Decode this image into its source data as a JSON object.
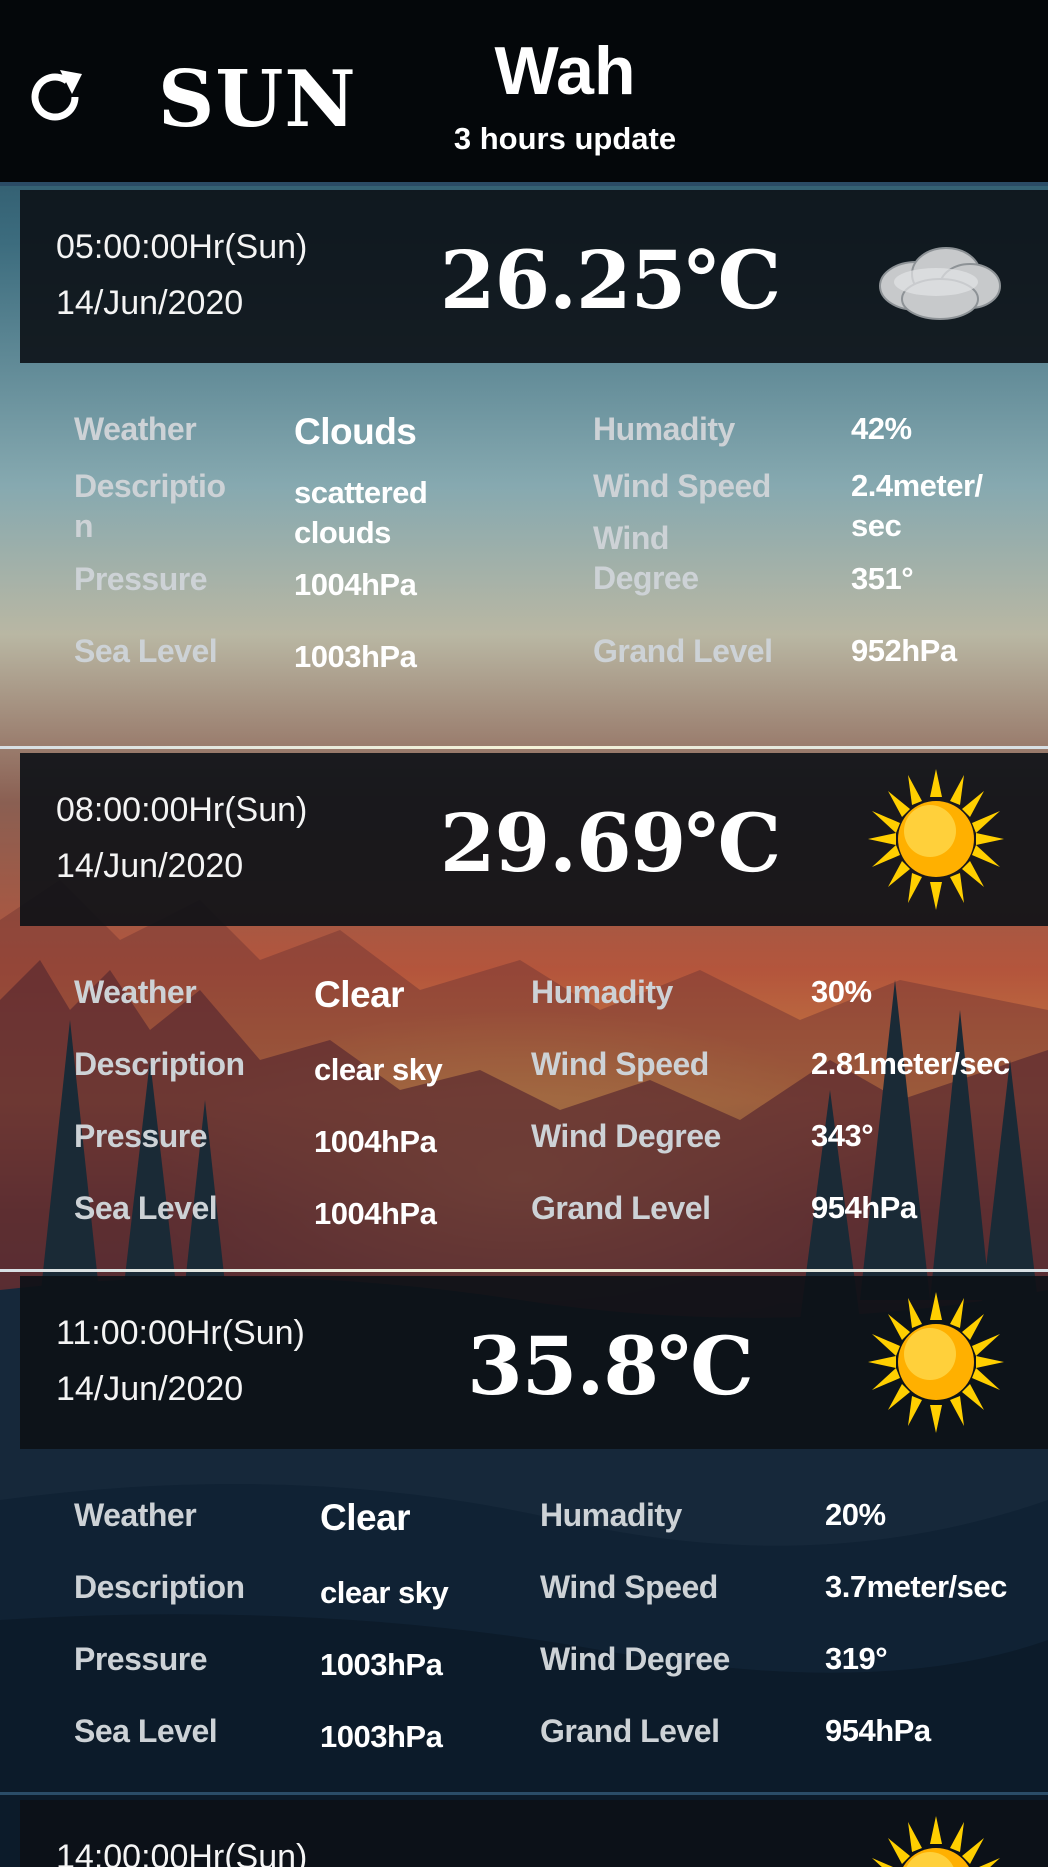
{
  "header": {
    "day": "SUN",
    "city": "Wah",
    "update_note": "3 hours update"
  },
  "forecasts": [
    {
      "time": "05:00:00Hr(Sun)",
      "date": "14/Jun/2020",
      "temperature": "26.25℃",
      "icon": "cloud-icon",
      "weather_label": "Weather",
      "weather": "Clouds",
      "description_label": "Descriptio\nn",
      "description": "scattered\nclouds",
      "pressure_label": "Pressure",
      "pressure": "1004hPa",
      "sea_level_label": "Sea Level",
      "sea_level": "1003hPa",
      "humidity_label": "Humadity",
      "humidity": "42%",
      "wind_speed_label": "Wind Speed",
      "wind_speed": "2.4meter/\nsec",
      "wind_degree_label": "Wind\nDegree",
      "wind_degree": "351°",
      "grand_level_label": "Grand Level",
      "grand_level": "952hPa"
    },
    {
      "time": "08:00:00Hr(Sun)",
      "date": "14/Jun/2020",
      "temperature": "29.69℃",
      "icon": "sun-icon",
      "weather_label": "Weather",
      "weather": "Clear",
      "description_label": "Description",
      "description": "clear sky",
      "pressure_label": "Pressure",
      "pressure": "1004hPa",
      "sea_level_label": "Sea Level",
      "sea_level": "1004hPa",
      "humidity_label": "Humadity",
      "humidity": "30%",
      "wind_speed_label": "Wind Speed",
      "wind_speed": "2.81meter/sec",
      "wind_degree_label": "Wind Degree",
      "wind_degree": "343°",
      "grand_level_label": "Grand Level",
      "grand_level": "954hPa"
    },
    {
      "time": "11:00:00Hr(Sun)",
      "date": "14/Jun/2020",
      "temperature": "35.8℃",
      "icon": "sun-icon",
      "weather_label": "Weather",
      "weather": "Clear",
      "description_label": "Description",
      "description": "clear sky",
      "pressure_label": "Pressure",
      "pressure": "1003hPa",
      "sea_level_label": "Sea Level",
      "sea_level": "1003hPa",
      "humidity_label": "Humadity",
      "humidity": "20%",
      "wind_speed_label": "Wind Speed",
      "wind_speed": "3.7meter/sec",
      "wind_degree_label": "Wind Degree",
      "wind_degree": "319°",
      "grand_level_label": "Grand Level",
      "grand_level": "954hPa"
    },
    {
      "time": "14:00:00Hr(Sun)",
      "icon": "sun-icon"
    }
  ],
  "icons": {
    "refresh": "refresh-icon",
    "cloud": "cloud-icon",
    "sun": "sun-icon"
  },
  "colors": {
    "header_bar": "#04070a",
    "card_header": "#0c1116",
    "label_text": "#cdd2d6",
    "value_text": "#ffffff",
    "sun_yellow": "#ffc400"
  }
}
